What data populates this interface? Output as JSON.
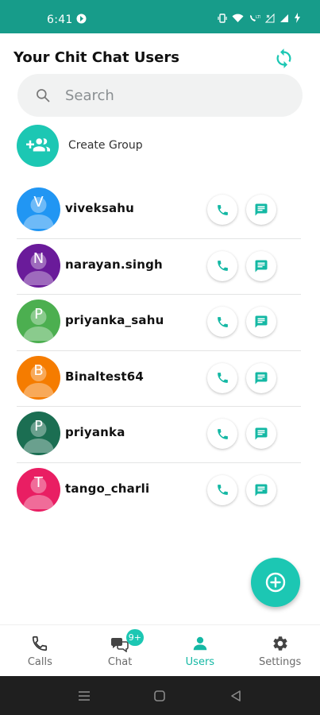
{
  "status_bar": {
    "time": "6:41",
    "background": "#179c8a"
  },
  "header": {
    "title": "Your Chit Chat Users",
    "refresh_icon": "refresh-icon"
  },
  "search": {
    "placeholder": "Search",
    "value": ""
  },
  "create_group": {
    "label": "Create Group",
    "icon": "group-add-icon"
  },
  "users": [
    {
      "name": "viveksahu",
      "initial": "V",
      "color": "#2196f3"
    },
    {
      "name": "narayan.singh",
      "initial": "N",
      "color": "#6a1b9a"
    },
    {
      "name": "priyanka_sahu",
      "initial": "P",
      "color": "#4caf50"
    },
    {
      "name": "Binaltest64",
      "initial": "B",
      "color": "#f57c00"
    },
    {
      "name": "priyanka",
      "initial": "P",
      "color": "#1b6e52"
    },
    {
      "name": "tango_charli",
      "initial": "T",
      "color": "#e91e63"
    }
  ],
  "fab": {
    "icon": "add-icon"
  },
  "bottom_nav": {
    "items": [
      {
        "label": "Calls",
        "icon": "phone-icon"
      },
      {
        "label": "Chat",
        "icon": "chat-icon",
        "badge": "9+"
      },
      {
        "label": "Users",
        "icon": "person-icon",
        "active": true
      },
      {
        "label": "Settings",
        "icon": "gear-icon"
      }
    ]
  },
  "colors": {
    "accent": "#1cc7b3",
    "active_nav": "#14b8a4"
  }
}
